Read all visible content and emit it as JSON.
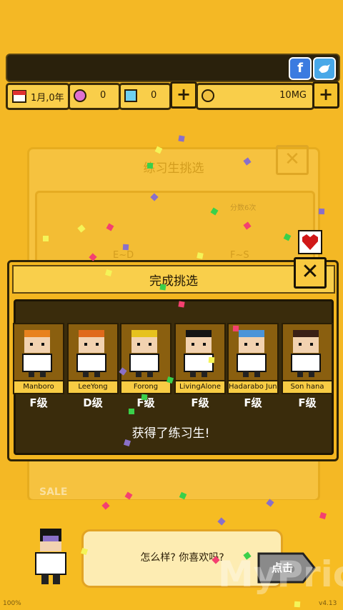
{
  "top": {
    "date": "1月,0年",
    "gems": "0",
    "crystals": "0",
    "money": "10MG",
    "facebook": "f"
  },
  "background_panel": {
    "title": "练习生挑选",
    "filter_label": "分数6次",
    "grade_a": "E~D",
    "grade_b": "F~S",
    "sale": "SALE"
  },
  "modal": {
    "title": "完成挑选",
    "message": "获得了练习生!",
    "trainees": [
      {
        "name": "Manboro",
        "grade": "F级",
        "hair": "#e8821e"
      },
      {
        "name": "LeeYong",
        "grade": "D级",
        "hair": "#e06a1c"
      },
      {
        "name": "Forong",
        "grade": "F级",
        "hair": "#e6c21e"
      },
      {
        "name": "LivingAlone",
        "grade": "F级",
        "hair": "#141414"
      },
      {
        "name": "Hadarabo June",
        "grade": "F级",
        "hair": "#4a94d8"
      },
      {
        "name": "Son hana",
        "grade": "F级",
        "hair": "#3a2016"
      }
    ]
  },
  "dialog": {
    "text": "怎么样? 你喜欢吗?",
    "button": "点击"
  },
  "watermark": "MyPrice",
  "version": "v4.13",
  "percent": "100%"
}
